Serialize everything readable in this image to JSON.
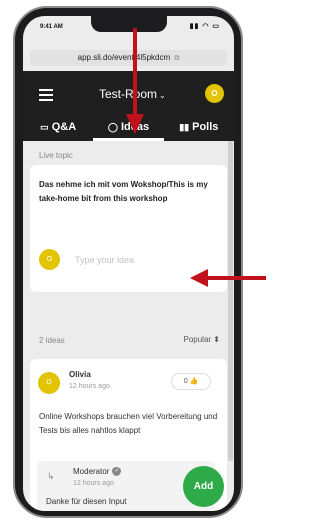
{
  "status": {
    "time": "9:41 AM",
    "icons": "▮▮ ◠ ▭"
  },
  "browser": {
    "url": "app.sli.do/event/4l5pkdcm",
    "copy_icon": "⧉"
  },
  "header": {
    "room_title": "Test-Room",
    "chevron": "⌄",
    "avatar_initial": "O"
  },
  "tabs": [
    {
      "icon": "▭",
      "label": "Q&A"
    },
    {
      "icon": "◯",
      "label": "Ideas"
    },
    {
      "icon": "▮▮",
      "label": "Polls"
    }
  ],
  "live_topic": {
    "label": "Live topic",
    "text": "Das nehme ich mit vom Wokshop/This is my take-home bit from this workshop",
    "avatar_initial": "O",
    "input_placeholder": "Type your idea",
    "input_value": ""
  },
  "ideas_header": {
    "count": "2 ideas",
    "sort_label": "Popular ⬍"
  },
  "idea_post": {
    "avatar_initial": "O",
    "author": "Olivia",
    "time": "12 hours ago",
    "likes": "0 👍",
    "text": "Online Workshops brauchen viel Vorbereitung und Tests bis alles nahtlos klappt",
    "reply": {
      "arrow": "↳",
      "author": "Moderator",
      "badge": "✓",
      "time": "12 hours ago",
      "text": "Danke für diesen Input"
    }
  },
  "add_button": {
    "label": "Add"
  },
  "colors": {
    "appbar": "#1f1f1f",
    "accent_yellow": "#e2c400",
    "add_green": "#2eaa48",
    "annotation_arrow": "#c0111c"
  }
}
